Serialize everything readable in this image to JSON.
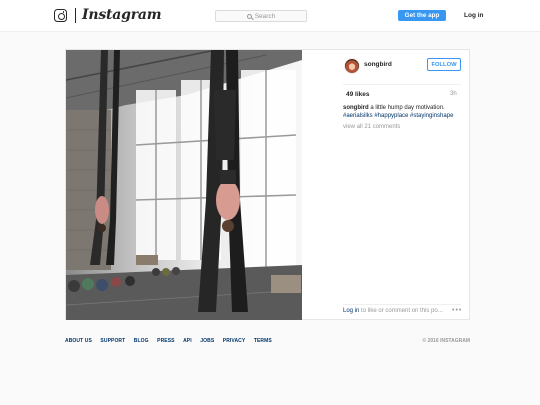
{
  "header": {
    "wordmark": "Instagram",
    "search_placeholder": "Search",
    "get_app_label": "Get the app",
    "login_label": "Log in"
  },
  "post": {
    "username": "songbird",
    "follow_label": "FOLLOW",
    "likes": "49 likes",
    "time_ago": "3h",
    "caption_user": "songbird",
    "caption_text": "a little hump day motivation.",
    "hashtags": "#aerialsilks #happyplace #stayinginshape",
    "view_all_comments": "view all 21 comments",
    "comment_login_link": "Log in",
    "comment_prompt": "to like or comment on this po...",
    "more_options": "•••"
  },
  "footer": {
    "links": [
      "ABOUT US",
      "SUPPORT",
      "BLOG",
      "PRESS",
      "API",
      "JOBS",
      "PRIVACY",
      "TERMS"
    ],
    "copyright": "© 2016 INSTAGRAM"
  },
  "colors": {
    "accent": "#3897f0",
    "link": "#003569",
    "muted": "#999999"
  }
}
